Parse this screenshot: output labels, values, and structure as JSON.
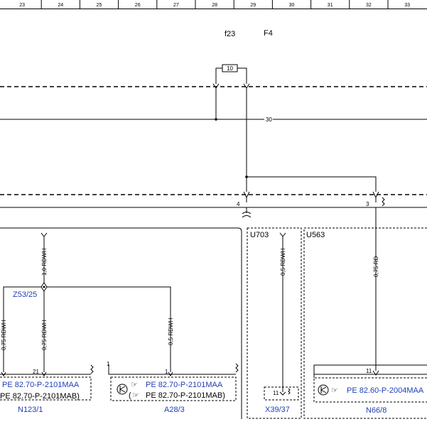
{
  "ruler": [
    "23",
    "24",
    "25",
    "26",
    "27",
    "28",
    "29",
    "30",
    "31",
    "32",
    "33"
  ],
  "fuse": {
    "name": "f23",
    "label": "F4",
    "rating": "10"
  },
  "bus_labels": {
    "terminal": "30",
    "pin_left": "4",
    "pin_right": "3"
  },
  "units": {
    "u703": "U703",
    "u563": "U563"
  },
  "splice": {
    "label": "Z53/25"
  },
  "wires": {
    "trunk": "1,0 RDWH",
    "left_a": "0,75 RDWH",
    "left_b": "0,75 RDWH",
    "a28": "0,5 RDWH",
    "x39": "0,5 RDWH",
    "n66": "0,75 RD"
  },
  "pins": {
    "n123": "21",
    "a28": "1",
    "a28_corner": "1",
    "x39": "11",
    "n66": "11"
  },
  "components": {
    "n123": {
      "name": "N123/1",
      "ref1": "PE 82.70-P-2101MAA",
      "ref2": "PE 82.70-P-2101MAB)"
    },
    "a28": {
      "name": "A28/3",
      "ref1": "PE 82.70-P-2101MAA",
      "ref2": "PE 82.70-P-2101MAB)",
      "paren": "("
    },
    "x39": {
      "name": "X39/37"
    },
    "n66": {
      "name": "N66/8",
      "ref1": "PE 82.60-P-2004MAA"
    }
  },
  "colors": {
    "link": "#1f3fb5",
    "line": "#000000"
  }
}
